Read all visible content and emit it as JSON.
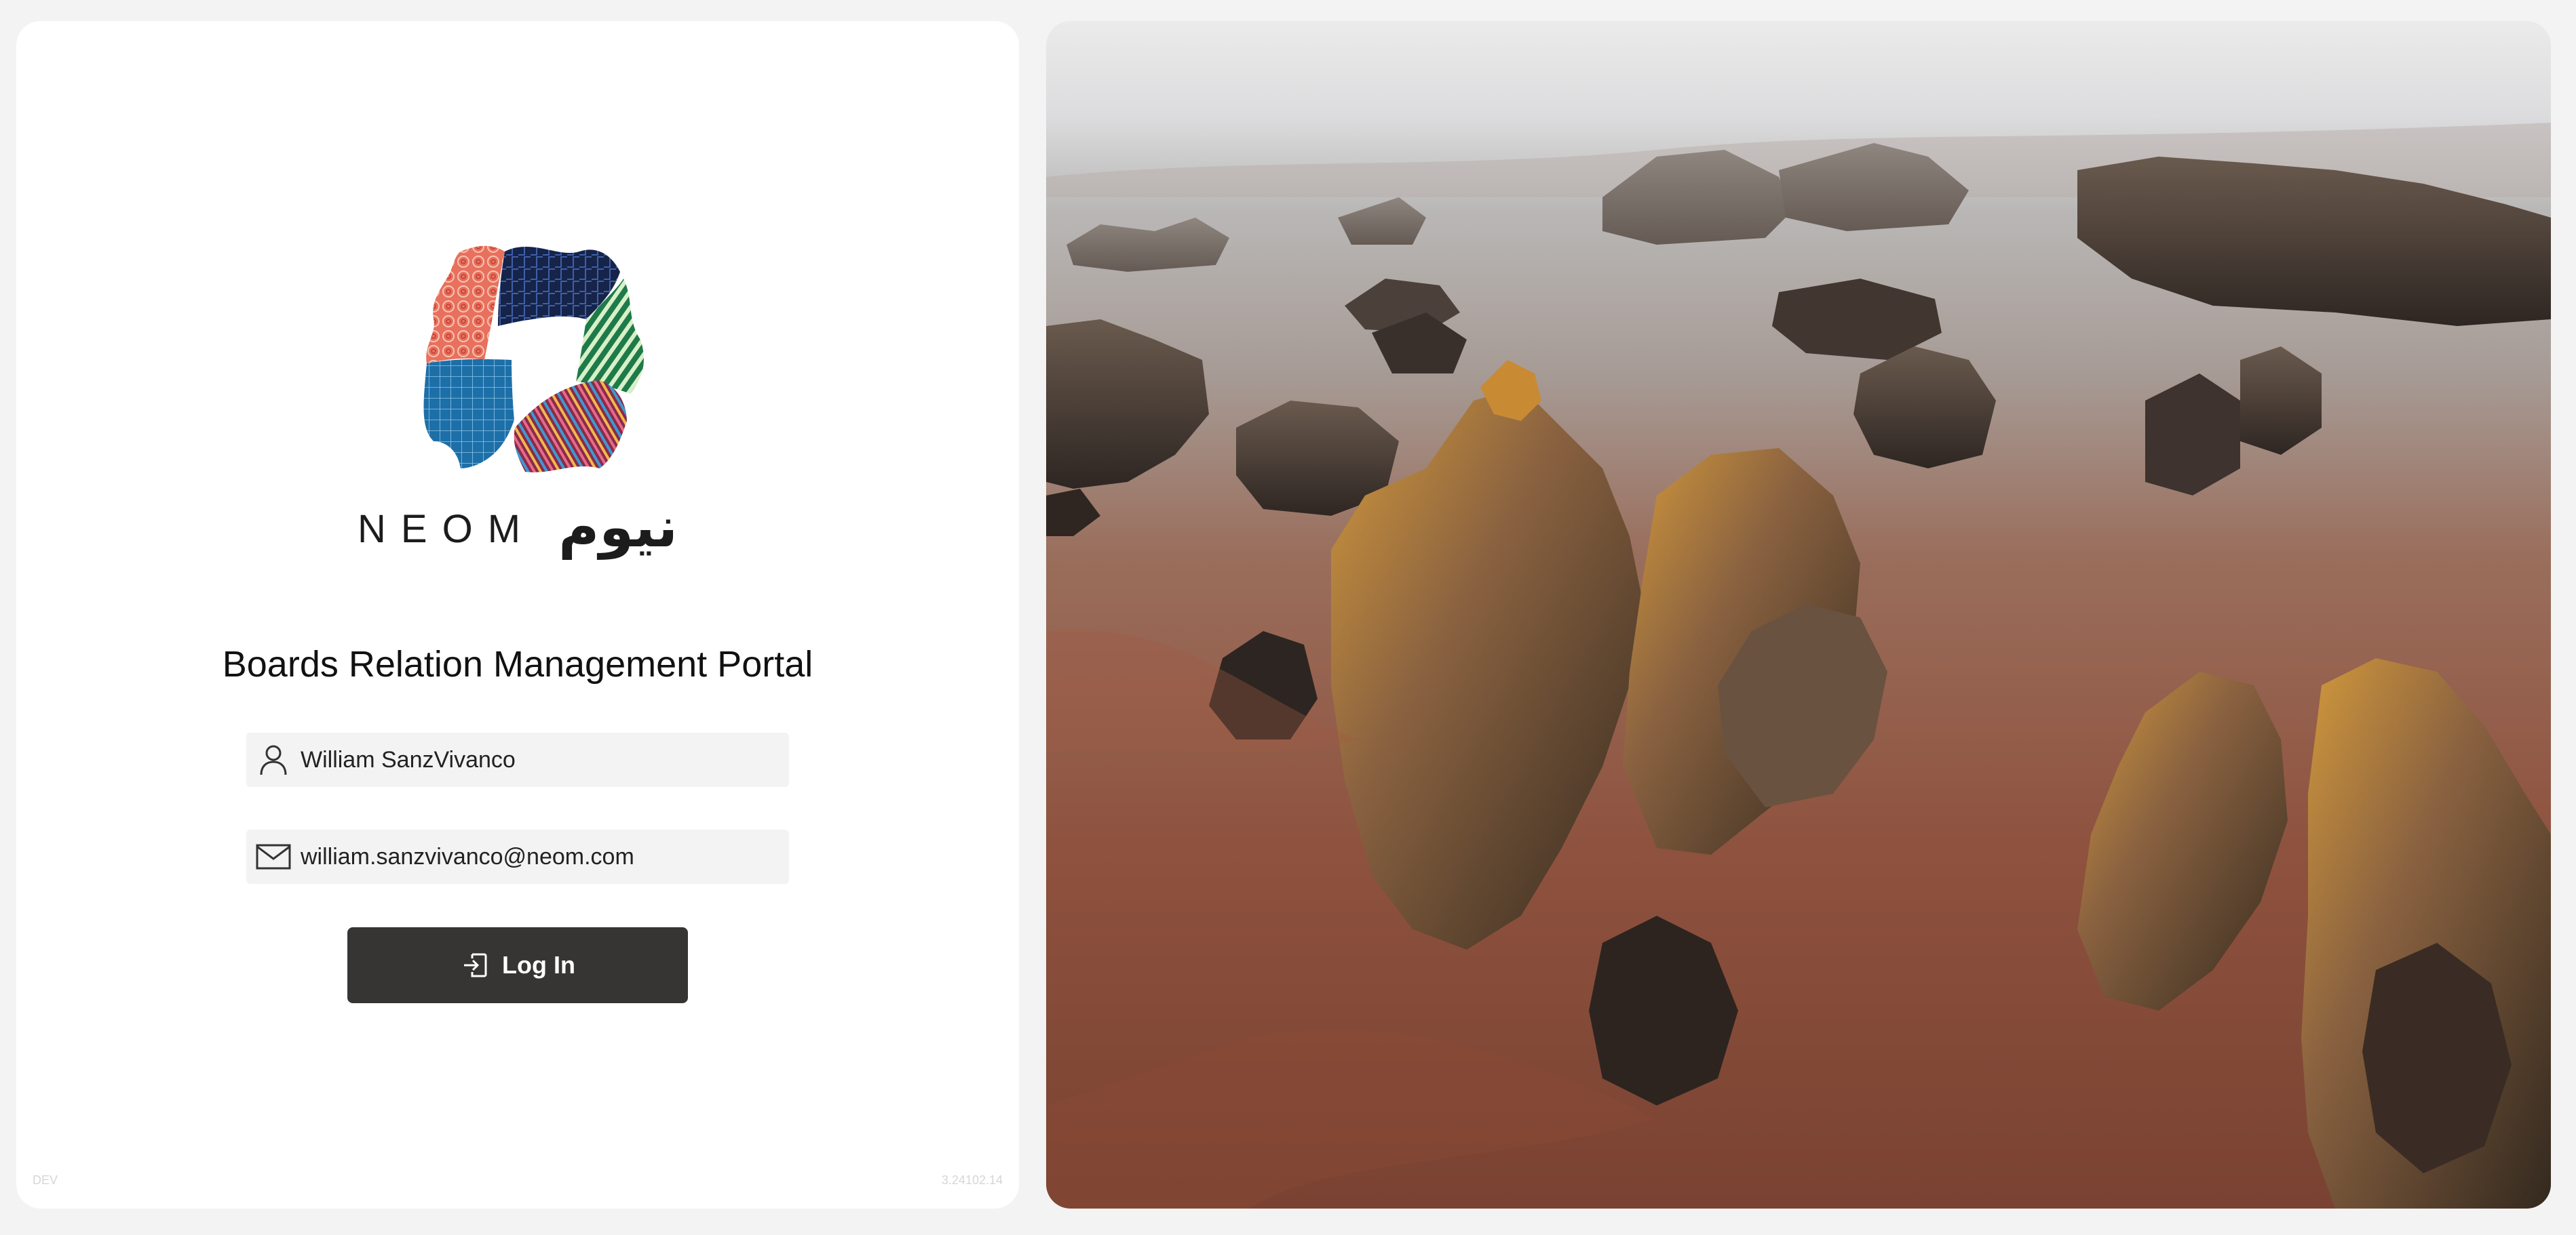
{
  "brand": {
    "wordmark_latin": "NEOM",
    "wordmark_arabic": "نيوم"
  },
  "portal": {
    "title": "Boards Relation Management Portal"
  },
  "form": {
    "name_value": "William SanzVivanco",
    "email_value": "william.sanzvivanco@neom.com",
    "name_icon": "user-icon",
    "email_icon": "mail-icon",
    "login_label": "Log In",
    "login_icon": "sign-in-icon"
  },
  "footer": {
    "environment": "DEV",
    "version": "3.24102.14"
  },
  "hero": {
    "subject": "desert-rock-formations-photo"
  },
  "colors": {
    "button": "#373534",
    "field_bg": "#f3f3f3",
    "page_bg": "#f3f3f3",
    "card_bg": "#ffffff"
  }
}
